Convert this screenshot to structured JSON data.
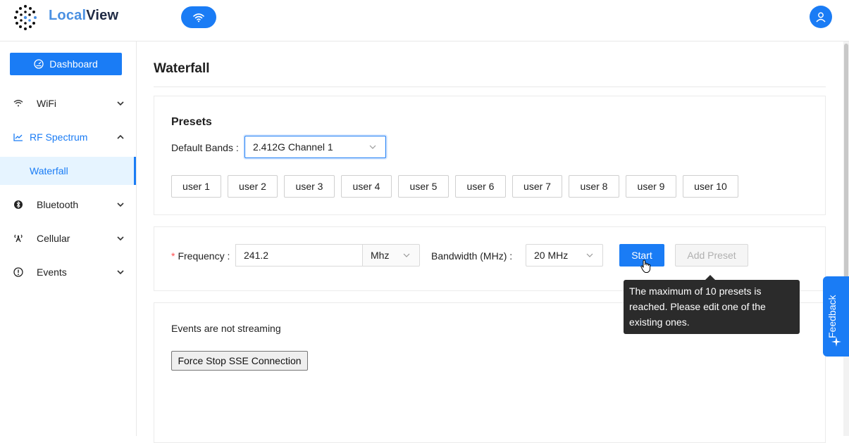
{
  "app": {
    "brand_part1": "Local",
    "brand_part2": "View"
  },
  "sidebar": {
    "dashboard_label": "Dashboard",
    "items": [
      {
        "label": "WiFi",
        "icon": "wifi-icon"
      },
      {
        "label": "RF Spectrum",
        "icon": "line-chart-icon"
      },
      {
        "label": "Waterfall",
        "icon": ""
      },
      {
        "label": "Bluetooth",
        "icon": "bluetooth-icon"
      },
      {
        "label": "Cellular",
        "icon": "antenna-icon"
      },
      {
        "label": "Events",
        "icon": "alert-circle-icon"
      }
    ]
  },
  "main": {
    "title": "Waterfall",
    "presets": {
      "heading": "Presets",
      "default_bands_label": "Default Bands",
      "default_bands_value": "2.412G Channel 1",
      "buttons": [
        "user 1",
        "user 2",
        "user 3",
        "user 4",
        "user 5",
        "user 6",
        "user 7",
        "user 8",
        "user 9",
        "user 10"
      ]
    },
    "controls": {
      "frequency_label": "Frequency",
      "frequency_value": "241.2",
      "frequency_unit": "Mhz",
      "bandwidth_label": "Bandwidth (MHz)",
      "bandwidth_value": "20 MHz",
      "start_label": "Start",
      "add_preset_label": "Add Preset"
    },
    "tooltip": "The maximum of 10 presets is reached. Please edit one of the existing ones.",
    "events": {
      "status_text": "Events are not streaming",
      "force_stop_label": "Force Stop SSE Connection"
    }
  },
  "feedback_label": "Feedback",
  "colors": {
    "accent": "#1a7cf5",
    "tooltip_bg": "#2b2b2b",
    "required": "#ff4d4f"
  }
}
